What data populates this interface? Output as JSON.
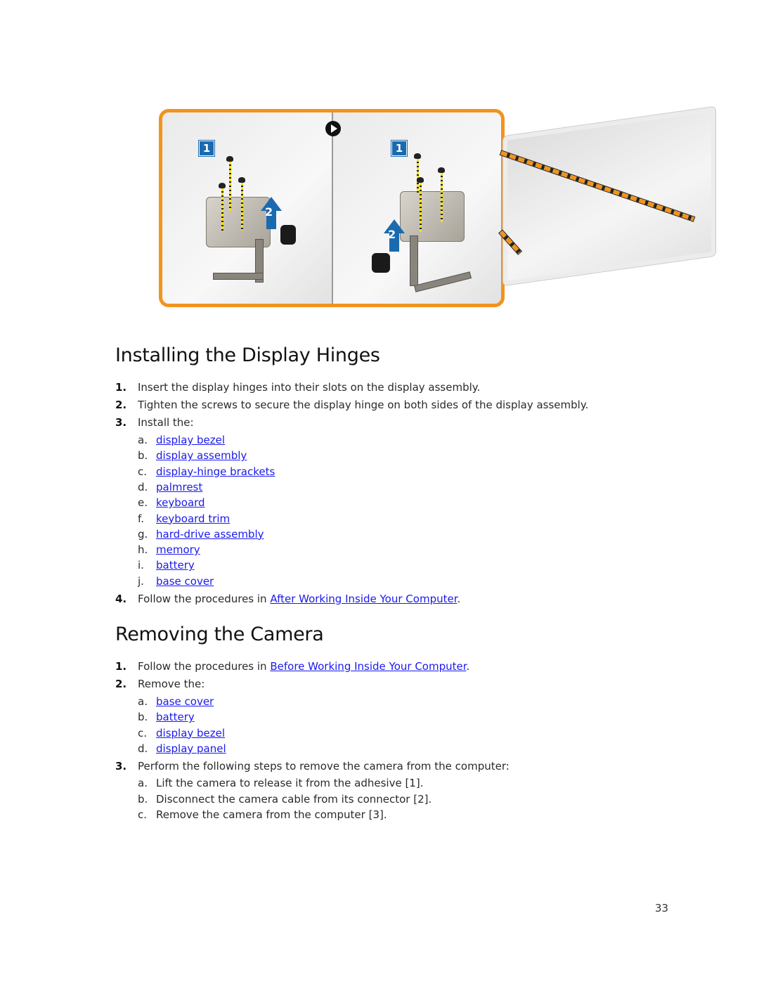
{
  "figure": {
    "left_panel_callouts": [
      "1",
      "2"
    ],
    "right_panel_callouts": [
      "1",
      "2"
    ],
    "icons": [
      "play-icon",
      "callout-1-icon",
      "callout-2-arrow-icon",
      "screw-icon"
    ],
    "colors": {
      "frame": "#f0941e",
      "callout": "#1a6ab0",
      "screw_guide": "#f5e11a"
    }
  },
  "section1": {
    "title": "Installing the Display Hinges",
    "steps": [
      {
        "num": "1.",
        "text": "Insert the display hinges into their slots on the display assembly."
      },
      {
        "num": "2.",
        "text": "Tighten the screws to secure the display hinge on both sides of the display assembly."
      },
      {
        "num": "3.",
        "text": "Install the:"
      },
      {
        "num": "4.",
        "text_before": "Follow the procedures in ",
        "link": "After Working Inside Your Computer",
        "text_after": "."
      }
    ],
    "install_items": [
      {
        "letter": "a.",
        "label": "display bezel"
      },
      {
        "letter": "b.",
        "label": "display assembly"
      },
      {
        "letter": "c.",
        "label": "display-hinge brackets"
      },
      {
        "letter": "d.",
        "label": "palmrest"
      },
      {
        "letter": "e.",
        "label": "keyboard"
      },
      {
        "letter": "f.",
        "label": "keyboard trim"
      },
      {
        "letter": "g.",
        "label": "hard-drive assembly"
      },
      {
        "letter": "h.",
        "label": "memory"
      },
      {
        "letter": "i.",
        "label": "battery"
      },
      {
        "letter": "j.",
        "label": "base cover"
      }
    ]
  },
  "section2": {
    "title": "Removing the Camera",
    "steps": [
      {
        "num": "1.",
        "text_before": "Follow the procedures in ",
        "link": "Before Working Inside Your Computer",
        "text_after": "."
      },
      {
        "num": "2.",
        "text": "Remove the:"
      },
      {
        "num": "3.",
        "text": "Perform the following steps to remove the camera from the computer:"
      }
    ],
    "remove_items": [
      {
        "letter": "a.",
        "label": "base cover"
      },
      {
        "letter": "b.",
        "label": "battery"
      },
      {
        "letter": "c.",
        "label": "display bezel"
      },
      {
        "letter": "d.",
        "label": "display panel"
      }
    ],
    "substeps": [
      {
        "letter": "a.",
        "text": "Lift the camera to release it from the adhesive [1]."
      },
      {
        "letter": "b.",
        "text": "Disconnect the camera cable from its connector [2]."
      },
      {
        "letter": "c.",
        "text": "Remove the camera from the computer [3]."
      }
    ]
  },
  "page_number": "33"
}
